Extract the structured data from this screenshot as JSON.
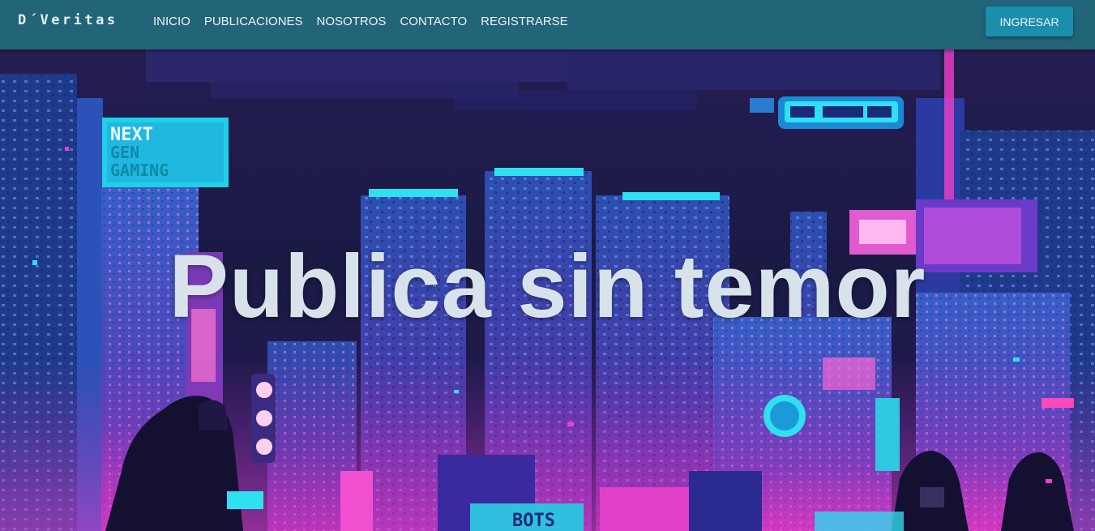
{
  "navbar": {
    "brand": "D´Veritas",
    "links": [
      {
        "label": "INICIO"
      },
      {
        "label": "PUBLICACIONES"
      },
      {
        "label": "NOSOTROS"
      },
      {
        "label": "CONTACTO"
      },
      {
        "label": "REGISTRARSE"
      }
    ],
    "login_label": "INGRESAR"
  },
  "hero": {
    "title": "Publica sin temor",
    "sign_next": "NEXT",
    "sign_gen": "GEN",
    "sign_gaming": "GAMING",
    "sign_bots": "BOTS"
  },
  "colors": {
    "navbar_bg": "#226478",
    "button_bg": "#1b8eac",
    "neon_cyan": "#2fe0f0",
    "neon_pink": "#f040c8",
    "title_text": "#d8e2ea"
  }
}
